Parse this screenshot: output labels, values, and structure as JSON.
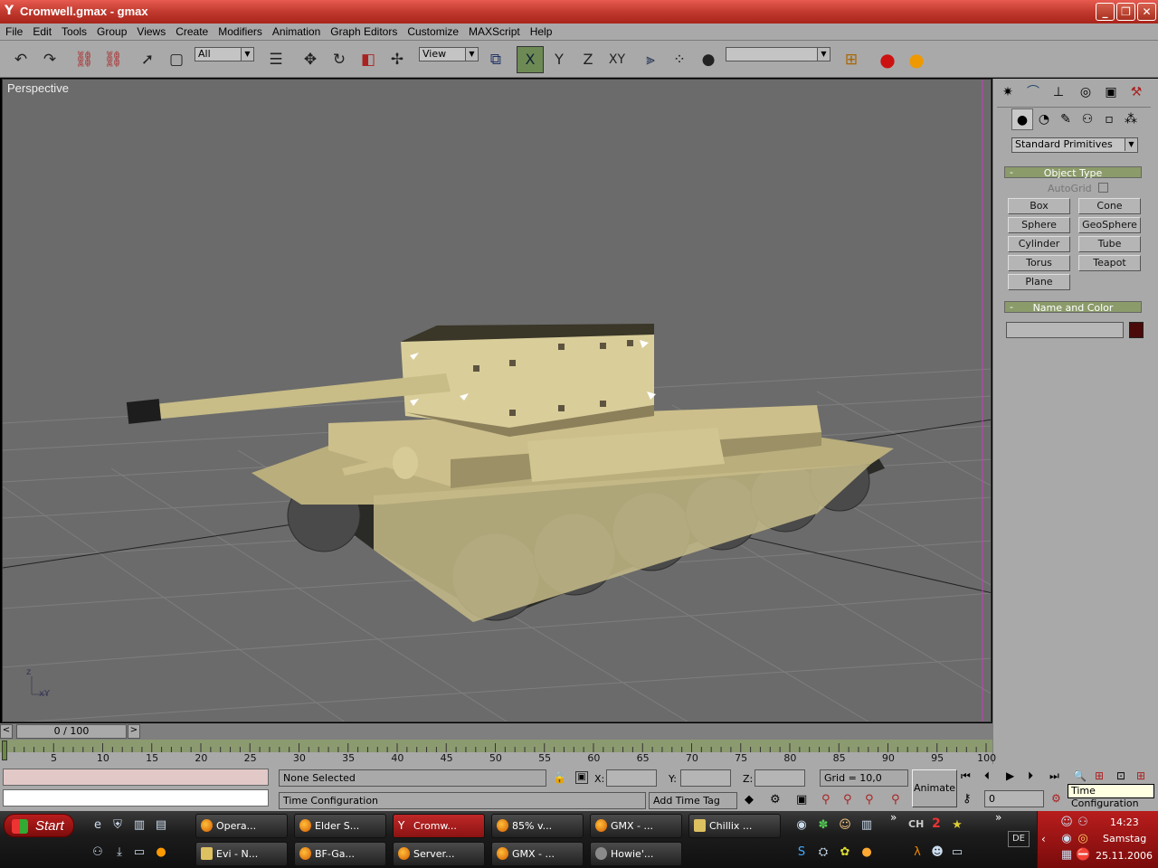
{
  "window": {
    "title": "Cromwell.gmax - gmax",
    "min_label": "_",
    "max_label": "❐",
    "close_label": "✕"
  },
  "menu": [
    "File",
    "Edit",
    "Tools",
    "Group",
    "Views",
    "Create",
    "Modifiers",
    "Animation",
    "Graph Editors",
    "Customize",
    "MAXScript",
    "Help"
  ],
  "toolbar": {
    "selection_filter": "All",
    "ref_coord": "View",
    "axis_x": "X",
    "axis_y": "Y",
    "axis_z": "Z",
    "axis_xy": "XY",
    "named_selection": ""
  },
  "viewport": {
    "label": "Perspective",
    "axis_z": "z",
    "axis_xy": "xY"
  },
  "command_panel": {
    "dropdown": "Standard Primitives",
    "object_type": {
      "title": "Object Type",
      "autogrid": "AutoGrid",
      "buttons": [
        "Box",
        "Cone",
        "Sphere",
        "GeoSphere",
        "Cylinder",
        "Tube",
        "Torus",
        "Teapot",
        "Plane"
      ]
    },
    "name_color": {
      "title": "Name and Color",
      "name_value": "",
      "color": "#4a0a0a"
    },
    "collapse_symbol": "-"
  },
  "timeline": {
    "frame_display": "0 / 100",
    "prev": "<",
    "next": ">",
    "ticks": [
      "5",
      "10",
      "15",
      "20",
      "25",
      "30",
      "35",
      "40",
      "45",
      "50",
      "55",
      "60",
      "65",
      "70",
      "75",
      "80",
      "85",
      "90",
      "95",
      "100"
    ]
  },
  "status": {
    "selection": "None Selected",
    "prompt": "Time Configuration",
    "x_label": "X:",
    "y_label": "Y:",
    "z_label": "Z:",
    "grid": "Grid = 10,0",
    "add_time_tag": "Add Time Tag",
    "animate": "Animate",
    "frame_value": "0",
    "tooltip": "Time Configuration"
  },
  "taskbar": {
    "start": "Start",
    "tasks_row1": [
      {
        "label": "Opera..."
      },
      {
        "label": "Elder S..."
      },
      {
        "label": "Cromw...",
        "active": true
      },
      {
        "label": "85% v..."
      },
      {
        "label": "GMX - ..."
      },
      {
        "label": "Chillix ..."
      }
    ],
    "tasks_row2": [
      {
        "label": "Evi - N..."
      },
      {
        "label": "BF-Ga..."
      },
      {
        "label": "Server..."
      },
      {
        "label": "GMX - ..."
      },
      {
        "label": "Howie'..."
      }
    ],
    "lang": "DE",
    "chevron": "»",
    "clock_time": "14:23",
    "clock_day": "Samstag",
    "clock_date": "25.11.2006",
    "tray_ch": "CH",
    "tray_2": "2"
  }
}
